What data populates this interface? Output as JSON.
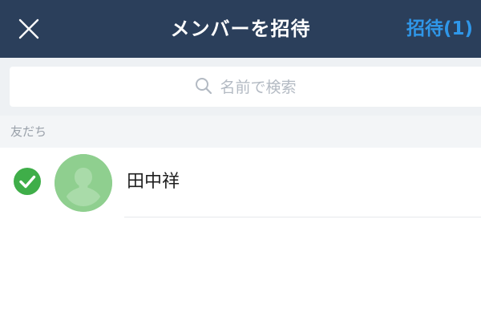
{
  "header": {
    "title": "メンバーを招待",
    "invite_label": "招待(1)",
    "close_icon": "close-icon",
    "background_color": "#2b3f5b",
    "accent_color": "#2f97e9"
  },
  "search": {
    "placeholder": "名前で検索",
    "icon": "search-icon"
  },
  "section": {
    "label": "友だち"
  },
  "friends": [
    {
      "name": "田中祥",
      "selected": true,
      "check_color": "#3fae49",
      "avatar_icon": "person-silhouette-icon",
      "avatar_color": "#8fcf8f"
    }
  ]
}
